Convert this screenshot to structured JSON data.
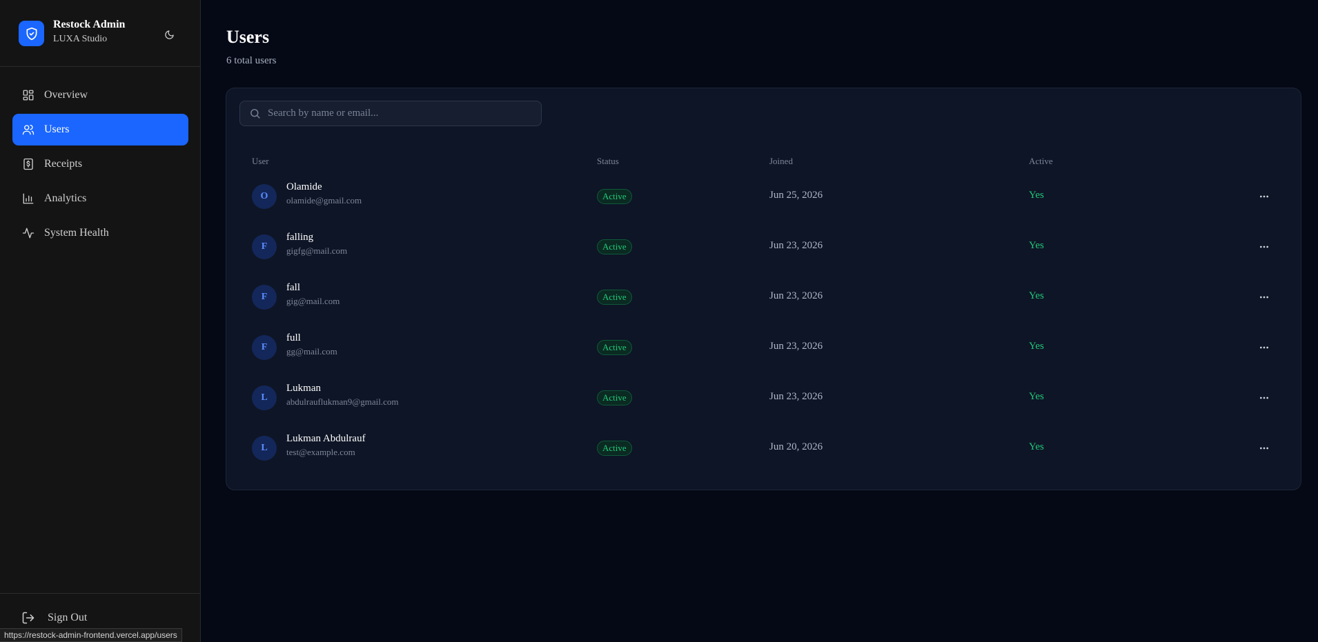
{
  "brand": {
    "title": "Restock Admin",
    "subtitle": "LUXA Studio"
  },
  "sidebar": {
    "items": [
      {
        "label": "Overview",
        "icon": "layout-grid-icon"
      },
      {
        "label": "Users",
        "icon": "users-icon",
        "active": true
      },
      {
        "label": "Receipts",
        "icon": "receipt-icon"
      },
      {
        "label": "Analytics",
        "icon": "bar-chart-icon"
      },
      {
        "label": "System Health",
        "icon": "activity-icon"
      }
    ],
    "signout_label": "Sign Out"
  },
  "status_url": "https://restock-admin-frontend.vercel.app/users",
  "page": {
    "title": "Users",
    "subtitle": "6 total users"
  },
  "search": {
    "placeholder": "Search by name or email...",
    "value": ""
  },
  "table": {
    "headers": {
      "user": "User",
      "status": "Status",
      "joined": "Joined",
      "active": "Active"
    },
    "rows": [
      {
        "initial": "O",
        "name": "Olamide",
        "email": "olamide@gmail.com",
        "status": "Active",
        "joined": "Jun 25, 2026",
        "active": "Yes"
      },
      {
        "initial": "F",
        "name": "falling",
        "email": "gigfg@mail.com",
        "status": "Active",
        "joined": "Jun 23, 2026",
        "active": "Yes"
      },
      {
        "initial": "F",
        "name": "fall",
        "email": "gig@mail.com",
        "status": "Active",
        "joined": "Jun 23, 2026",
        "active": "Yes"
      },
      {
        "initial": "F",
        "name": "full",
        "email": "gg@mail.com",
        "status": "Active",
        "joined": "Jun 23, 2026",
        "active": "Yes"
      },
      {
        "initial": "L",
        "name": "Lukman",
        "email": "abdulrauflukman9@gmail.com",
        "status": "Active",
        "joined": "Jun 23, 2026",
        "active": "Yes"
      },
      {
        "initial": "L",
        "name": "Lukman Abdulrauf",
        "email": "test@example.com",
        "status": "Active",
        "joined": "Jun 20, 2026",
        "active": "Yes"
      }
    ]
  },
  "colors": {
    "accent": "#1a66ff",
    "success": "#22c97a",
    "background": "#050916",
    "sidebar": "#141414",
    "card": "#0e1526"
  }
}
